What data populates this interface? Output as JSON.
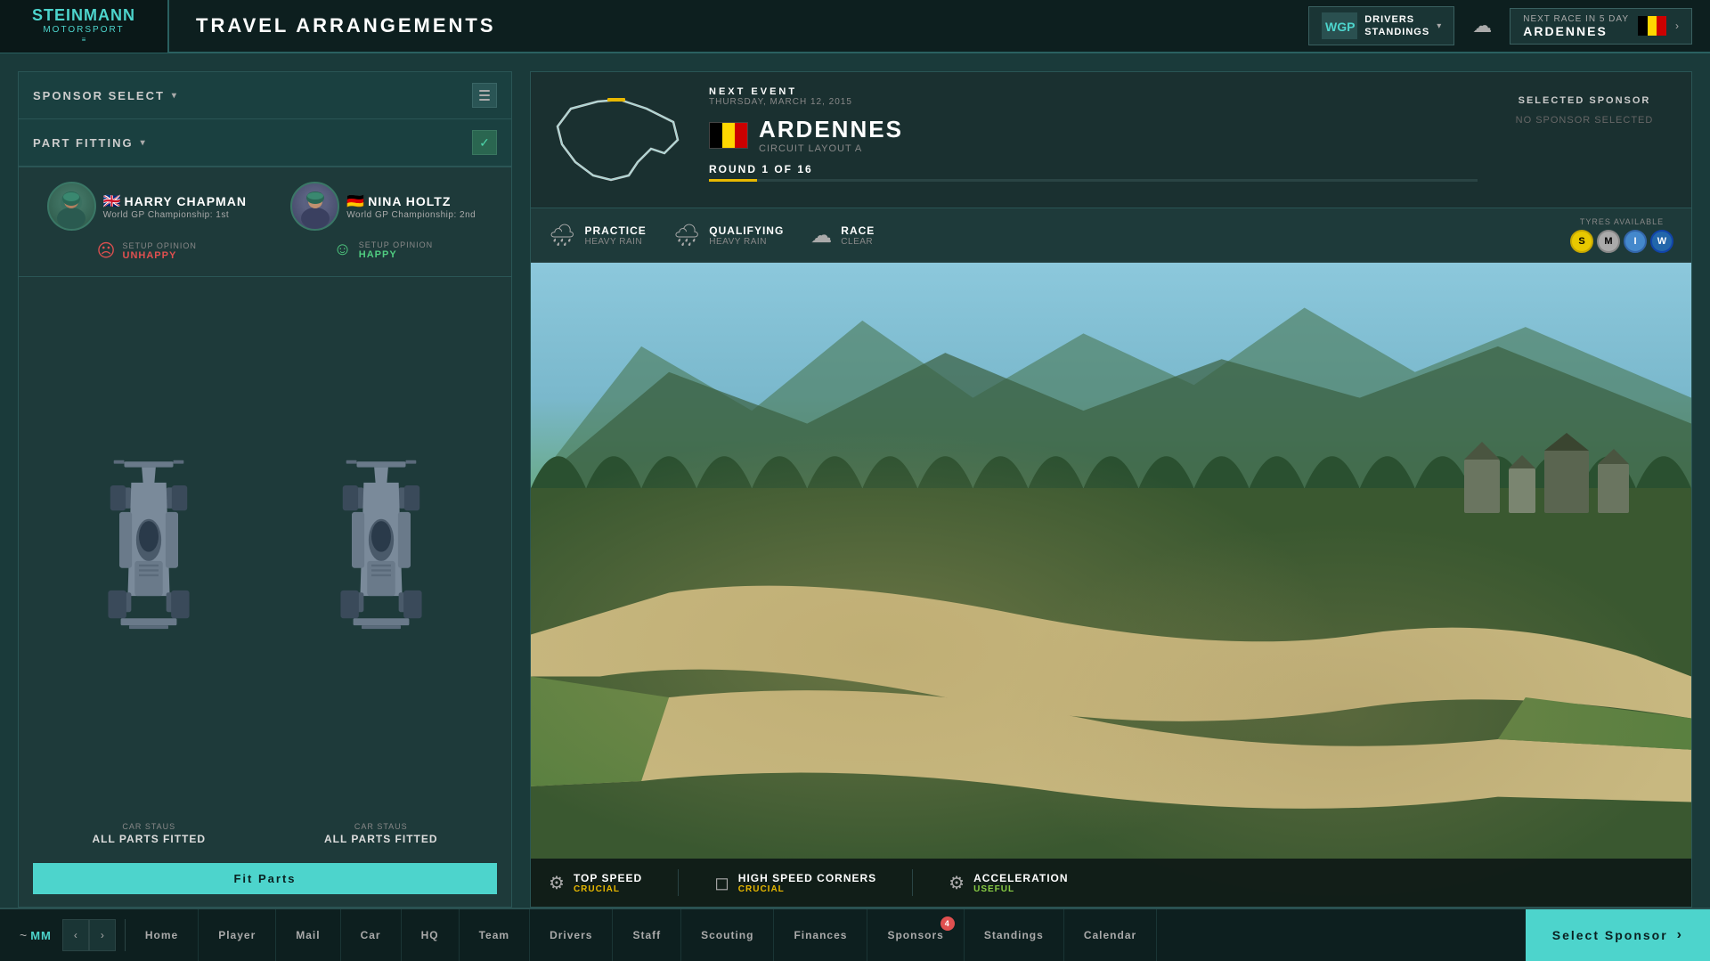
{
  "topbar": {
    "logo_line1": "STEINMANN",
    "logo_line2": "MOTORSPORT",
    "page_title": "TRAVEL ARRANGEMENTS",
    "standings_label1": "DRIVERS",
    "standings_label2": "STANDINGS",
    "next_race_prefix": "NEXT RACE IN 5 DAY",
    "next_race_name": "ARDENNES"
  },
  "left_panel": {
    "sponsor_select_label": "SPONSOR SELECT",
    "part_fitting_label": "PART FITTING",
    "driver1": {
      "name": "HARRY CHAPMAN",
      "championship": "World GP Championship: 1st",
      "opinion_label": "SETUP OPINION",
      "opinion_status": "UNHAPPY",
      "opinion_type": "unhappy"
    },
    "driver2": {
      "name": "NINA HOLTZ",
      "championship": "World GP Championship: 2nd",
      "opinion_label": "SETUP OPINION",
      "opinion_status": "HAPPY",
      "opinion_type": "happy"
    },
    "car1_status_label": "CAR STAUS",
    "car1_status": "ALL PARTS FITTED",
    "car2_status_label": "CAR STAUS",
    "car2_status": "ALL PARTS FITTED",
    "fit_parts_btn": "Fit Parts"
  },
  "right_panel": {
    "next_event_label": "NEXT EVENT",
    "event_date": "THURSDAY, MARCH 12, 2015",
    "event_name": "ARDENNES",
    "event_circuit": "CIRCUIT LAYOUT A",
    "round_text": "ROUND 1 OF 16",
    "selected_sponsor_label": "SELECTED SPONSOR",
    "no_sponsor_text": "NO SPONSOR SELECTED",
    "weather": {
      "practice_label": "PRACTICE",
      "practice_cond": "HEAVY RAIN",
      "qualifying_label": "QUALIFYING",
      "qualifying_cond": "HEAVY RAIN",
      "race_label": "RACE",
      "race_cond": "CLEAR",
      "tyres_label": "TYRES AVAILABLE",
      "tyre_s": "S",
      "tyre_m": "M",
      "tyre_i": "I",
      "tyre_w": "W"
    },
    "track_stats": [
      {
        "name": "TOP SPEED",
        "level": "CRUCIAL"
      },
      {
        "name": "HIGH SPEED CORNERS",
        "level": "CRUCIAL"
      },
      {
        "name": "ACCELERATION",
        "level": "USEFUL"
      }
    ]
  },
  "bottom_nav": {
    "items": [
      {
        "label": "Home",
        "badge": null
      },
      {
        "label": "Player",
        "badge": null
      },
      {
        "label": "Mail",
        "badge": null
      },
      {
        "label": "Car",
        "badge": null
      },
      {
        "label": "HQ",
        "badge": null
      },
      {
        "label": "Team",
        "badge": null
      },
      {
        "label": "Drivers",
        "badge": null
      },
      {
        "label": "Staff",
        "badge": null
      },
      {
        "label": "Scouting",
        "badge": null
      },
      {
        "label": "Finances",
        "badge": null
      },
      {
        "label": "Sponsors",
        "badge": "4"
      },
      {
        "label": "Standings",
        "badge": null
      },
      {
        "label": "Calendar",
        "badge": null
      }
    ],
    "select_sponsor_label": "Select Sponsor"
  }
}
